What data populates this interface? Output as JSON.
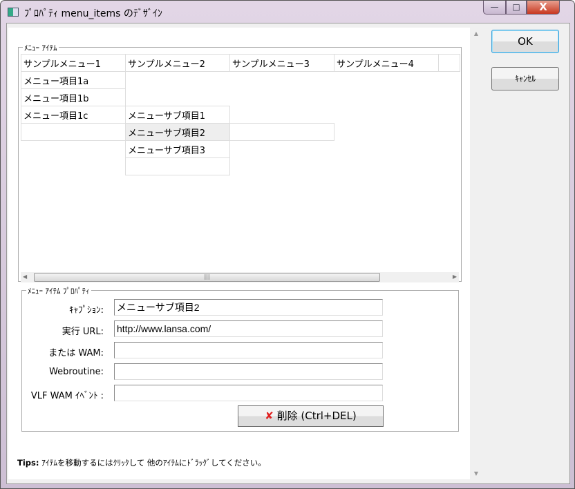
{
  "window": {
    "title": "ﾌﾟﾛﾊﾟﾃｨ menu_items のﾃﾞｻﾞｲﾝ",
    "minimize": "—",
    "maximize": "□",
    "close": "X"
  },
  "menu_group": {
    "label": "ﾒﾆｭｰ ｱｲﾃﾑ",
    "headers": [
      "サンプルメニュー1",
      "サンプルメニュー2",
      "サンプルメニュー3",
      "サンプルメニュー4"
    ],
    "col1_items": [
      "メニュー項目1a",
      "メニュー項目1b",
      "メニュー項目1c"
    ],
    "col2_items": [
      "メニューサブ項目1",
      "メニューサブ項目2",
      "メニューサブ項目3"
    ],
    "selected": "メニューサブ項目2"
  },
  "props": {
    "label": "ﾒﾆｭｰ ｱｲﾃﾑ ﾌﾟﾛﾊﾟﾃｨ",
    "fields": [
      {
        "label": "ｷｬﾌﾟｼｮﾝ:",
        "value": "メニューサブ項目2"
      },
      {
        "label": "実行 URL:",
        "value": "http://www.lansa.com/"
      },
      {
        "label": "または WAM:",
        "value": ""
      },
      {
        "label": "Webroutine:",
        "value": ""
      },
      {
        "label": "VLF WAM ｲﾍﾞﾝﾄ :",
        "value": ""
      }
    ],
    "delete_label": "削除 (Ctrl+DEL)"
  },
  "buttons": {
    "ok": "OK",
    "cancel": "ｷｬﾝｾﾙ"
  },
  "tips": {
    "title": "Tips:",
    "text": " ｱｲﾃﾑを移動するにはｸﾘｯｸして 他のｱｲﾃﾑにﾄﾞﾗｯｸﾞしてください。"
  },
  "colors": {
    "accent": "#3c9fd8",
    "delete_icon": "#e02020"
  }
}
